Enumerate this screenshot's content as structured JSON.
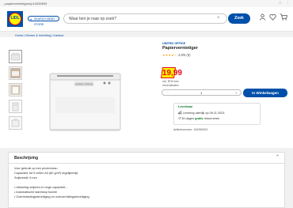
{
  "browser": {
    "url": "...papiervernietigers/p10039693",
    "star": "☆",
    "menu": "⋮"
  },
  "header": {
    "logo_text": "LIDL",
    "location_label": "SEARCH NEAR STORE",
    "search_placeholder": "Waar ben je naar op zoek?",
    "clear": "×",
    "search_button": "Zoek",
    "icons": [
      "user-icon",
      "heart-icon",
      "cart-icon"
    ]
  },
  "breadcrumb": "Home | Wonen & Inrichting | Kantoor",
  "product": {
    "brand": "UNITED OFFICE",
    "title": "Papiervernietiger",
    "stars": "★★★★☆",
    "rating_text": "3.8/5 (8)",
    "price": "19,99",
    "vat": "Incl. BTW excl.",
    "unit": "verzendkosten",
    "qty_minus": "−",
    "qty_value": "1",
    "qty_plus": "+",
    "cart_button": "In Winkelwagen",
    "delivery_label": "Leverbaar",
    "delivery_line1": "Levering uiterlijk op 09.11.2023",
    "delivery_line2_prefix": "30 dagen",
    "delivery_line2_bold": "gratis",
    "delivery_line2_suffix": "retourneren",
    "article": "Artikelnummer: 100390003"
  },
  "description": {
    "title": "Beschrijving",
    "chevron": "⌃",
    "lines": [
      "Voor gebruik op een privéniveau",
      "Capaciteit: tot 5 vellen A4 (80 g/m²) tegelijkertijd",
      "Snijbreedt: 6 mm",
      "",
      "• Ultrachtig snijmes en hoge capaciteit...",
      "• Automatische start/stop functie",
      "• Overbelastingsbeveiliging en oververhittingsbeveiliging"
    ]
  }
}
